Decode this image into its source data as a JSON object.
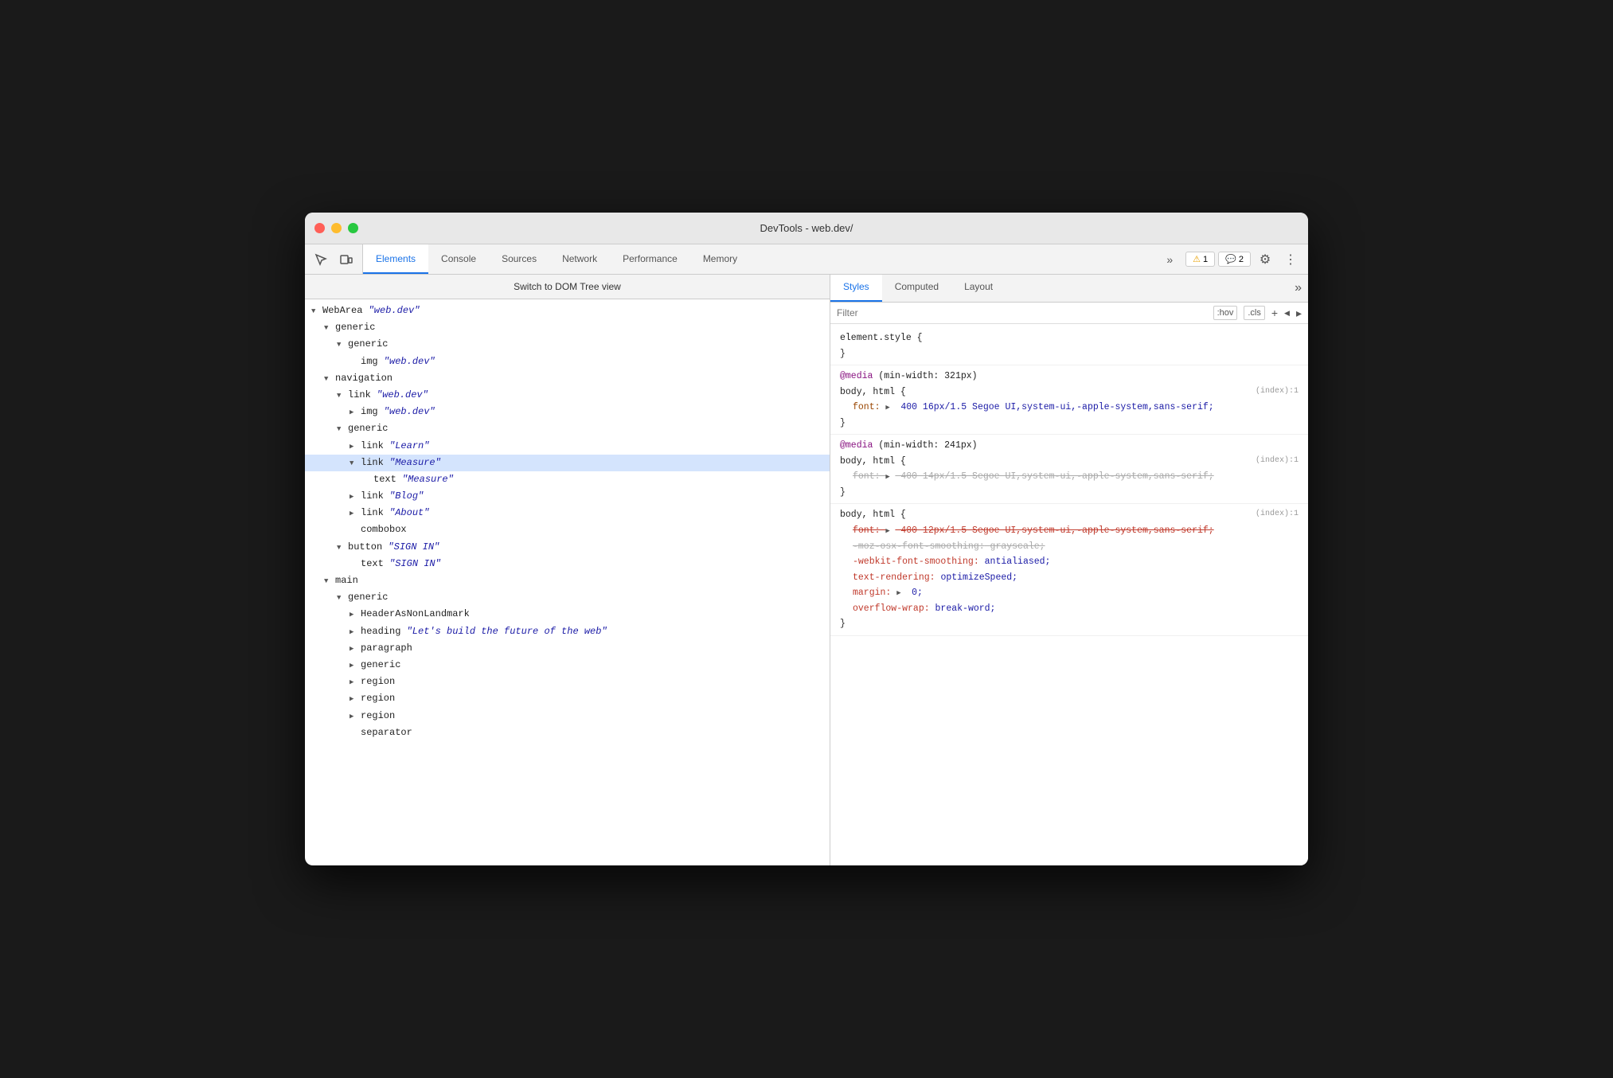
{
  "window": {
    "title": "DevTools - web.dev/"
  },
  "titlebar": {
    "traffic_lights": [
      "red",
      "yellow",
      "green"
    ]
  },
  "devtools_tabs": {
    "tabs": [
      {
        "label": "Elements",
        "active": true
      },
      {
        "label": "Console",
        "active": false
      },
      {
        "label": "Sources",
        "active": false
      },
      {
        "label": "Network",
        "active": false
      },
      {
        "label": "Performance",
        "active": false
      },
      {
        "label": "Memory",
        "active": false
      }
    ],
    "more_label": "»",
    "warn_count": "1",
    "info_count": "2"
  },
  "dom_panel": {
    "toolbar_label": "Switch to DOM Tree view",
    "tree": [
      {
        "text": "WebArea \"web.dev\"",
        "indent": 0,
        "arrow": "open"
      },
      {
        "text": "generic",
        "indent": 1,
        "arrow": "open"
      },
      {
        "text": "generic",
        "indent": 2,
        "arrow": "open"
      },
      {
        "text": "img \"web.dev\"",
        "indent": 3,
        "arrow": "none"
      },
      {
        "text": "navigation",
        "indent": 1,
        "arrow": "open"
      },
      {
        "text": "link \"web.dev\"",
        "indent": 2,
        "arrow": "open"
      },
      {
        "text": "img \"web.dev\"",
        "indent": 3,
        "arrow": "closed"
      },
      {
        "text": "generic",
        "indent": 2,
        "arrow": "open"
      },
      {
        "text": "link \"Learn\"",
        "indent": 3,
        "arrow": "closed"
      },
      {
        "text": "link \"Measure\"",
        "indent": 3,
        "arrow": "open",
        "selected": true
      },
      {
        "text": "text \"Measure\"",
        "indent": 4,
        "arrow": "none"
      },
      {
        "text": "link \"Blog\"",
        "indent": 3,
        "arrow": "closed"
      },
      {
        "text": "link \"About\"",
        "indent": 3,
        "arrow": "closed"
      },
      {
        "text": "combobox",
        "indent": 3,
        "arrow": "none"
      },
      {
        "text": "button \"SIGN IN\"",
        "indent": 2,
        "arrow": "open"
      },
      {
        "text": "text \"SIGN IN\"",
        "indent": 3,
        "arrow": "none"
      },
      {
        "text": "main",
        "indent": 1,
        "arrow": "open"
      },
      {
        "text": "generic",
        "indent": 2,
        "arrow": "open"
      },
      {
        "text": "HeaderAsNonLandmark",
        "indent": 3,
        "arrow": "closed"
      },
      {
        "text": "heading \"Let's build the future of the web\"",
        "indent": 3,
        "arrow": "closed"
      },
      {
        "text": "paragraph",
        "indent": 3,
        "arrow": "closed"
      },
      {
        "text": "generic",
        "indent": 3,
        "arrow": "closed"
      },
      {
        "text": "region",
        "indent": 3,
        "arrow": "closed"
      },
      {
        "text": "region",
        "indent": 3,
        "arrow": "closed"
      },
      {
        "text": "region",
        "indent": 3,
        "arrow": "closed"
      },
      {
        "text": "separator",
        "indent": 3,
        "arrow": "none"
      }
    ]
  },
  "styles_panel": {
    "tabs": [
      "Styles",
      "Computed",
      "Layout"
    ],
    "active_tab": "Styles",
    "more_label": "»",
    "filter": {
      "placeholder": "Filter",
      "hov_label": ":hov",
      "cls_label": ".cls"
    },
    "css_blocks": [
      {
        "type": "element",
        "selector": "element.style {",
        "close": "}",
        "lines": []
      },
      {
        "type": "media",
        "media": "@media (min-width: 321px)",
        "selector": "body, html {",
        "source": "(index):1",
        "close": "}",
        "lines": [
          {
            "prop": "font:",
            "val": "▶ 400 16px/1.5 Segoe UI,system-ui,-apple-system,sans-serif;",
            "strikethrough": false
          }
        ]
      },
      {
        "type": "media",
        "media": "@media (min-width: 241px)",
        "selector": "body, html {",
        "source": "(index):1",
        "close": "}",
        "lines": [
          {
            "prop": "font:",
            "val": "▶ 400 14px/1.5 Segoe UI,system-ui,-apple-system,sans-serif;",
            "strikethrough": true
          }
        ]
      },
      {
        "type": "rule",
        "selector": "body, html {",
        "source": "(index):1",
        "close": "}",
        "lines": [
          {
            "prop": "font:",
            "val": "▶ 400 12px/1.5 Segoe UI,system-ui,-apple-system,sans-serif;",
            "strikethrough": true,
            "red": true
          },
          {
            "prop": "-moz-osx-font-smoothing:",
            "val": "grayscale;",
            "strikethrough": true,
            "red": false
          },
          {
            "prop": "-webkit-font-smoothing:",
            "val": "antialiased;",
            "strikethrough": false,
            "red": true
          },
          {
            "prop": "text-rendering:",
            "val": "optimizeSpeed;",
            "strikethrough": false,
            "red": true
          },
          {
            "prop": "margin:",
            "val": "▶ 0;",
            "strikethrough": false,
            "red": true
          },
          {
            "prop": "overflow-wrap:",
            "val": "break-word;",
            "strikethrough": false,
            "red": true
          }
        ]
      }
    ]
  }
}
